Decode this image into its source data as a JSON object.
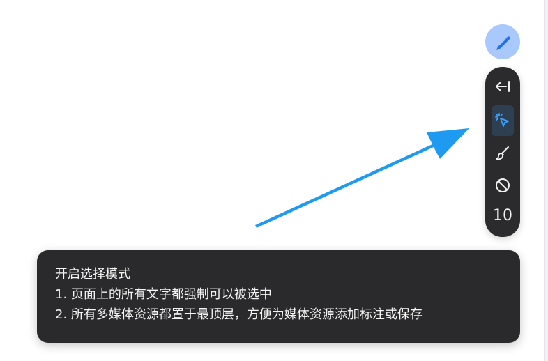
{
  "fab": {
    "icon": "pen-icon",
    "color": "#a9c8fb",
    "icon_color": "#1e6fe8"
  },
  "toolbar": {
    "tools": [
      {
        "name": "collapse",
        "icon": "arrow-left-bar-icon"
      },
      {
        "name": "select-mode",
        "icon": "cursor-click-icon",
        "active": true
      },
      {
        "name": "brush",
        "icon": "brush-icon"
      },
      {
        "name": "block",
        "icon": "ban-icon"
      }
    ],
    "counter": "10"
  },
  "arrow": {
    "color": "#1e9bf0"
  },
  "tooltip": {
    "title": "开启选择模式",
    "line1": "1. 页面上的所有文字都强制可以被选中",
    "line2": "2. 所有多媒体资源都置于最顶层，方便为媒体资源添加标注或保存"
  }
}
